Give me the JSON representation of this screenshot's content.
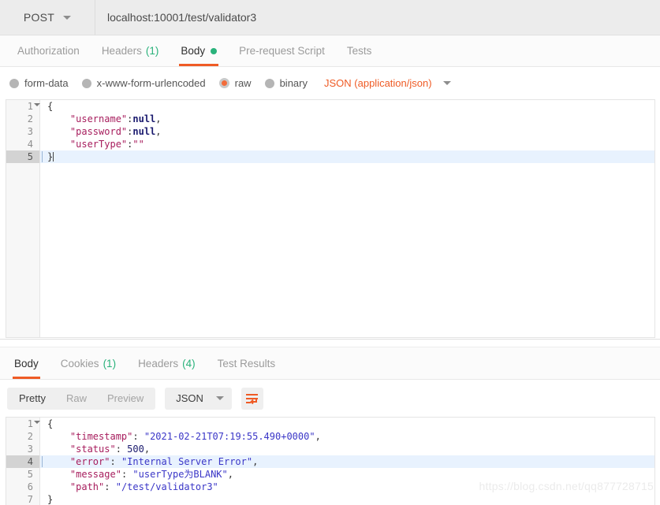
{
  "request_bar": {
    "method": "POST",
    "method_caret": "chevron-down-icon",
    "url": "localhost:10001/test/validator3"
  },
  "request_tabs": [
    {
      "label": "Authorization",
      "count": "",
      "active": false
    },
    {
      "label": "Headers",
      "count": "(1)",
      "active": false
    },
    {
      "label": "Body",
      "count": "",
      "active": true,
      "dot": true
    },
    {
      "label": "Pre-request Script",
      "count": "",
      "active": false
    },
    {
      "label": "Tests",
      "count": "",
      "active": false
    }
  ],
  "body_types": [
    {
      "label": "form-data",
      "selected": false
    },
    {
      "label": "x-www-form-urlencoded",
      "selected": false
    },
    {
      "label": "raw",
      "selected": true
    },
    {
      "label": "binary",
      "selected": false
    }
  ],
  "content_type": "JSON (application/json)",
  "request_body": {
    "lines": [
      {
        "n": "1",
        "fold": true,
        "active": false,
        "segments": [
          {
            "t": "{",
            "c": "pn"
          }
        ]
      },
      {
        "n": "2",
        "fold": false,
        "active": false,
        "segments": [
          {
            "t": "    ",
            "c": "pn"
          },
          {
            "t": "\"username\"",
            "c": "k"
          },
          {
            "t": ":",
            "c": "pn"
          },
          {
            "t": "null",
            "c": "nl"
          },
          {
            "t": ",",
            "c": "pn"
          }
        ]
      },
      {
        "n": "3",
        "fold": false,
        "active": false,
        "segments": [
          {
            "t": "    ",
            "c": "pn"
          },
          {
            "t": "\"password\"",
            "c": "k"
          },
          {
            "t": ":",
            "c": "pn"
          },
          {
            "t": "null",
            "c": "nl"
          },
          {
            "t": ",",
            "c": "pn"
          }
        ]
      },
      {
        "n": "4",
        "fold": false,
        "active": false,
        "segments": [
          {
            "t": "    ",
            "c": "pn"
          },
          {
            "t": "\"userType\"",
            "c": "k"
          },
          {
            "t": ":",
            "c": "pn"
          },
          {
            "t": "\"\"",
            "c": "k"
          }
        ]
      },
      {
        "n": "5",
        "fold": false,
        "active": true,
        "cursor": true,
        "segments": [
          {
            "t": "}",
            "c": "pn"
          }
        ]
      }
    ]
  },
  "response_tabs": [
    {
      "label": "Body",
      "count": "",
      "active": true
    },
    {
      "label": "Cookies",
      "count": "(1)",
      "active": false
    },
    {
      "label": "Headers",
      "count": "(4)",
      "active": false
    },
    {
      "label": "Test Results",
      "count": "",
      "active": false
    }
  ],
  "response_toolbar": {
    "views": [
      {
        "label": "Pretty",
        "active": true
      },
      {
        "label": "Raw",
        "active": false
      },
      {
        "label": "Preview",
        "active": false
      }
    ],
    "format": "JSON",
    "format_caret": "chevron-down-icon",
    "wrap_button": "word-wrap-icon"
  },
  "response_body": {
    "lines": [
      {
        "n": "1",
        "fold": true,
        "active": false,
        "segments": [
          {
            "t": "{",
            "c": "pn"
          }
        ]
      },
      {
        "n": "2",
        "fold": false,
        "active": false,
        "segments": [
          {
            "t": "    ",
            "c": "pn"
          },
          {
            "t": "\"timestamp\"",
            "c": "k"
          },
          {
            "t": ": ",
            "c": "pn"
          },
          {
            "t": "\"2021-02-21T07:19:55.490+0000\"",
            "c": "s"
          },
          {
            "t": ",",
            "c": "pn"
          }
        ]
      },
      {
        "n": "3",
        "fold": false,
        "active": false,
        "segments": [
          {
            "t": "    ",
            "c": "pn"
          },
          {
            "t": "\"status\"",
            "c": "k"
          },
          {
            "t": ": ",
            "c": "pn"
          },
          {
            "t": "500",
            "c": "num"
          },
          {
            "t": ",",
            "c": "pn"
          }
        ]
      },
      {
        "n": "4",
        "fold": false,
        "active": true,
        "segments": [
          {
            "t": "    ",
            "c": "pn"
          },
          {
            "t": "\"error\"",
            "c": "k"
          },
          {
            "t": ": ",
            "c": "pn"
          },
          {
            "t": "\"Internal Server Error\"",
            "c": "s"
          },
          {
            "t": ",",
            "c": "pn"
          }
        ]
      },
      {
        "n": "5",
        "fold": false,
        "active": false,
        "segments": [
          {
            "t": "    ",
            "c": "pn"
          },
          {
            "t": "\"message\"",
            "c": "k"
          },
          {
            "t": ": ",
            "c": "pn"
          },
          {
            "t": "\"userType为BLANK\"",
            "c": "s"
          },
          {
            "t": ",",
            "c": "pn"
          }
        ]
      },
      {
        "n": "6",
        "fold": false,
        "active": false,
        "segments": [
          {
            "t": "    ",
            "c": "pn"
          },
          {
            "t": "\"path\"",
            "c": "k"
          },
          {
            "t": ": ",
            "c": "pn"
          },
          {
            "t": "\"/test/validator3\"",
            "c": "s"
          }
        ]
      },
      {
        "n": "7",
        "fold": false,
        "active": false,
        "segments": [
          {
            "t": "}",
            "c": "pn"
          }
        ]
      }
    ]
  },
  "watermark": "https://blog.csdn.net/qq877728715",
  "colors": {
    "accent": "#ef5b25",
    "green": "#2ab27b",
    "key": "#a71d5d",
    "string": "#3a36c7",
    "active_line": "#e8f2fe"
  }
}
